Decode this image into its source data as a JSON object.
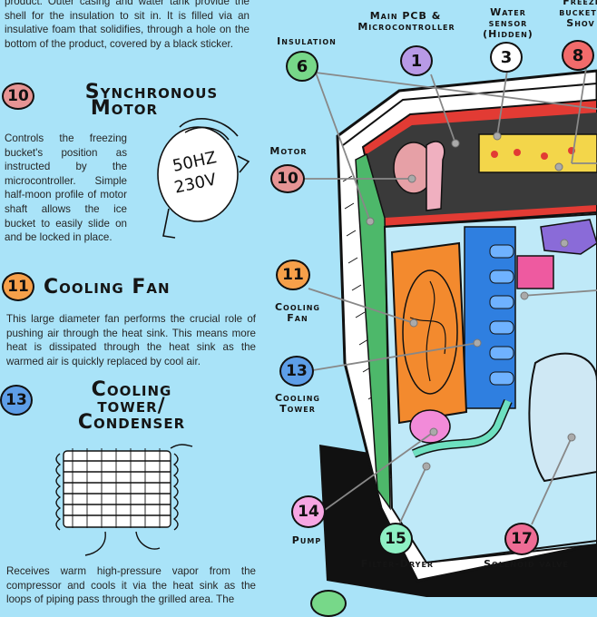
{
  "intro": {
    "text": "product. Outer casing and water tank provide the shell for the insulation to sit in. It is filled via an insulative foam that solidifies, through a hole on the bottom of the product, covered by a black sticker."
  },
  "sections": [
    {
      "number": "10",
      "title_line1": "Synchronous",
      "title_line2": "Motor",
      "description": "Controls the freezing bucket's position as instructed by the microcontroller. Simple half-moon profile of motor shaft allows the ice bucket to easily slide on and be locked in place.",
      "motor_label_1": "50HZ",
      "motor_label_2": "230V"
    },
    {
      "number": "11",
      "title": "Cooling Fan",
      "description": "This large diameter fan performs the crucial role of pushing air through the heat sink. This means more heat is dissipated through the heat sink as the warmed air is quickly replaced by cool air."
    },
    {
      "number": "13",
      "title_line1": "Cooling",
      "title_line2": "tower/",
      "title_line3": "Condenser",
      "description": "Receives warm high-pressure vapor from the compressor and cools it via the heat sink as the loops of piping pass through the grilled area. The"
    }
  ],
  "callouts": [
    {
      "number": "6",
      "label": "Insulation",
      "color": "#77d889"
    },
    {
      "number": "1",
      "label_line1": "Main PCB &",
      "label_line2": "Microcontroller",
      "color": "#b89ae6"
    },
    {
      "number": "3",
      "label_line1": "Water",
      "label_line2": "sensor",
      "label_line3": "(Hidden)",
      "color": "#ffffff"
    },
    {
      "number": "8",
      "label_line1": "Freezi",
      "label_line2": "bucket",
      "label_line3": "Shov",
      "color": "#f26b6b"
    },
    {
      "number": "10",
      "label": "Motor",
      "color": "#e69494"
    },
    {
      "number": "11",
      "label_line1": "Cooling",
      "label_line2": "Fan",
      "color": "#f7a04a"
    },
    {
      "number": "13",
      "label_line1": "Cooling",
      "label_line2": "Tower",
      "color": "#5d9ee8"
    },
    {
      "number": "14",
      "label": "Pump",
      "color": "#f7a6e3"
    },
    {
      "number": "15",
      "label": "Filter-Dryer",
      "color": "#8ef0c4"
    },
    {
      "number": "17",
      "label": "Solenoid valve",
      "color": "#ee6c95"
    }
  ]
}
